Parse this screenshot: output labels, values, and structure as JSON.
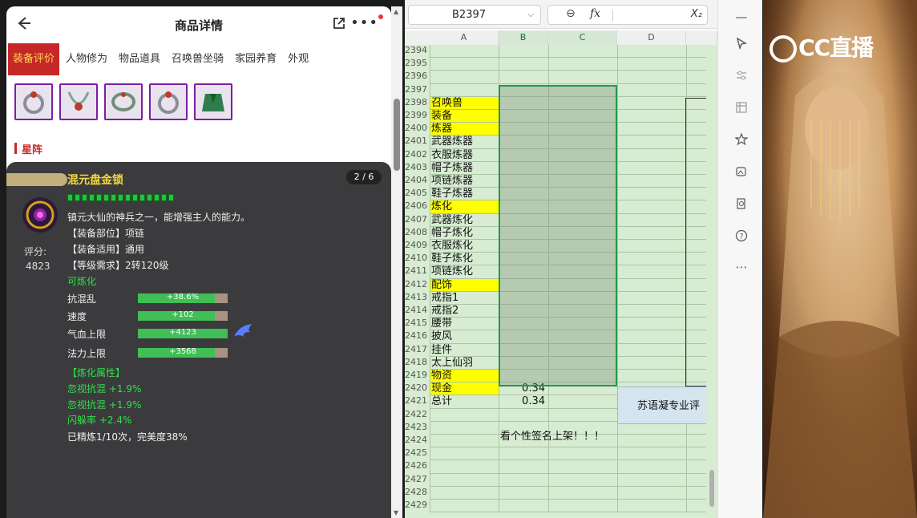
{
  "phone": {
    "title": "商品详情",
    "tabs": [
      "装备评价",
      "人物修为",
      "物品道具",
      "召唤兽坐骑",
      "家园养育",
      "外观"
    ],
    "section_title": "星阵",
    "item": {
      "name": "混元盘金锁",
      "page": "2 / 6",
      "score_label": "评分:",
      "score_value": "4823",
      "description": "镇元大仙的神兵之一，能增强主人的能力。",
      "part": "【装备部位】项链",
      "applies": "【装备适用】通用",
      "level": "【等级需求】2转120级",
      "refinable": "可炼化",
      "stats": [
        {
          "label": "抗混乱",
          "value": "+38.6%",
          "fill": 0.86
        },
        {
          "label": "速度",
          "value": "+102",
          "fill": 0.86
        },
        {
          "label": "气血上限",
          "value": "+4123",
          "fill": 1.0
        },
        {
          "label": "法力上限",
          "value": "+3568",
          "fill": 0.86
        }
      ],
      "refine_header": "【炼化属性】",
      "refine_attrs": [
        "忽视抗混 +1.9%",
        "忽视抗混 +1.9%",
        "闪躲率 +2.4%"
      ],
      "refine_summary": "已精炼1/10次，完美度38%",
      "gem_count": 15
    }
  },
  "sheet": {
    "name_box": "B2397",
    "columns": [
      "A",
      "B",
      "C",
      "D"
    ],
    "rows": [
      {
        "n": "2394",
        "a": "",
        "ay": false,
        "b": ""
      },
      {
        "n": "2395",
        "a": "",
        "ay": false,
        "b": ""
      },
      {
        "n": "2396",
        "a": "",
        "ay": false,
        "b": ""
      },
      {
        "n": "2397",
        "a": "",
        "ay": false,
        "b": ""
      },
      {
        "n": "2398",
        "a": "召唤兽",
        "ay": true,
        "b": ""
      },
      {
        "n": "2399",
        "a": "装备",
        "ay": true,
        "b": ""
      },
      {
        "n": "2400",
        "a": "炼器",
        "ay": true,
        "b": ""
      },
      {
        "n": "2401",
        "a": "武器炼器",
        "ay": false,
        "b": ""
      },
      {
        "n": "2402",
        "a": "衣服炼器",
        "ay": false,
        "b": ""
      },
      {
        "n": "2403",
        "a": "帽子炼器",
        "ay": false,
        "b": ""
      },
      {
        "n": "2404",
        "a": "项链炼器",
        "ay": false,
        "b": ""
      },
      {
        "n": "2405",
        "a": "鞋子炼器",
        "ay": false,
        "b": ""
      },
      {
        "n": "2406",
        "a": "炼化",
        "ay": true,
        "b": ""
      },
      {
        "n": "2407",
        "a": "武器炼化",
        "ay": false,
        "b": ""
      },
      {
        "n": "2408",
        "a": "帽子炼化",
        "ay": false,
        "b": ""
      },
      {
        "n": "2409",
        "a": "衣服炼化",
        "ay": false,
        "b": ""
      },
      {
        "n": "2410",
        "a": "鞋子炼化",
        "ay": false,
        "b": ""
      },
      {
        "n": "2411",
        "a": "项链炼化",
        "ay": false,
        "b": ""
      },
      {
        "n": "2412",
        "a": "配饰",
        "ay": true,
        "b": ""
      },
      {
        "n": "2413",
        "a": "戒指1",
        "ay": false,
        "b": ""
      },
      {
        "n": "2414",
        "a": "戒指2",
        "ay": false,
        "b": ""
      },
      {
        "n": "2415",
        "a": "腰带",
        "ay": false,
        "b": ""
      },
      {
        "n": "2416",
        "a": "披风",
        "ay": false,
        "b": ""
      },
      {
        "n": "2417",
        "a": "挂件",
        "ay": false,
        "b": ""
      },
      {
        "n": "2418",
        "a": "太上仙羽",
        "ay": false,
        "b": ""
      },
      {
        "n": "2419",
        "a": "物资",
        "ay": true,
        "b": ""
      },
      {
        "n": "2420",
        "a": "现金",
        "ay": true,
        "b": "0.34"
      },
      {
        "n": "2421",
        "a": "总计",
        "ay": false,
        "b": "0.34"
      },
      {
        "n": "2422",
        "a": "",
        "ay": false,
        "b": ""
      },
      {
        "n": "2423",
        "a": "",
        "ay": false,
        "b": ""
      },
      {
        "n": "2424",
        "a": "",
        "ay": false,
        "b": ""
      },
      {
        "n": "2425",
        "a": "",
        "ay": false,
        "b": ""
      },
      {
        "n": "2426",
        "a": "",
        "ay": false,
        "b": ""
      },
      {
        "n": "2427",
        "a": "",
        "ay": false,
        "b": ""
      },
      {
        "n": "2428",
        "a": "",
        "ay": false,
        "b": ""
      },
      {
        "n": "2429",
        "a": "",
        "ay": false,
        "b": ""
      }
    ],
    "banner_text": "看个性签名上架！！！",
    "textbox_text": "苏语凝专业评"
  },
  "stream": {
    "logo": "CC直播"
  },
  "colors": {
    "tab_active": "#c62828",
    "cell_yellow": "#ffff00",
    "sheet_bg": "#d7ecd2",
    "selection": "#1e9a4f",
    "stat_fill": "#3fbf55",
    "item_name": "#f5d742",
    "green_text": "#2ee04a"
  }
}
